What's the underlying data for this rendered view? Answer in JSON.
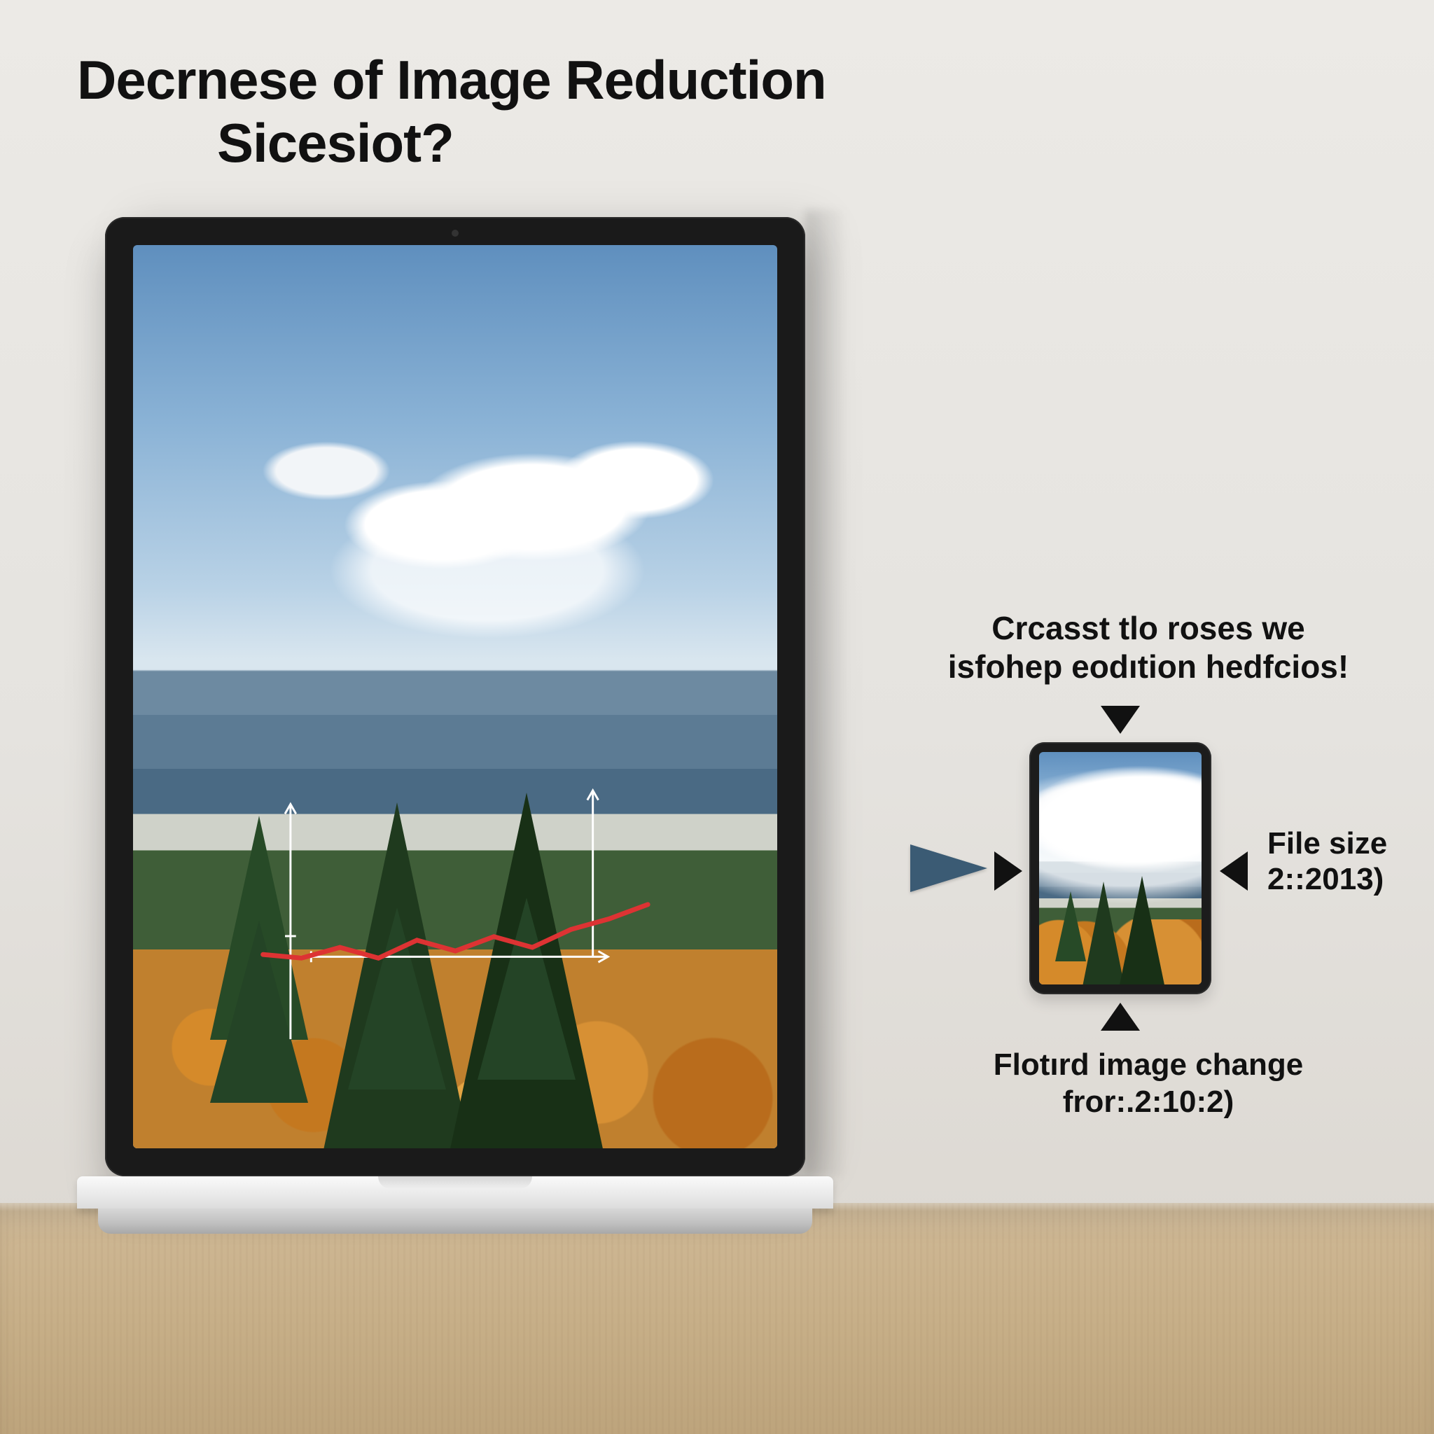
{
  "title": {
    "line1": "Decrnese of Image Reduction",
    "line2": "Sicesiot?"
  },
  "caption": {
    "line1": "Crcasst tlo roses we",
    "line2": "isfohep eodıtion hedfcios!"
  },
  "right_label": {
    "line1": "File size",
    "line2": "2::2013)"
  },
  "bottom_label": {
    "line1": "Flotırd image change",
    "line2": "fror:.2:10:2)"
  },
  "arrows": {
    "top": "down-triangle-icon",
    "bottom": "up-triangle-icon",
    "left": "right-triangle-icon",
    "right": "left-triangle-icon",
    "pointer": "pointer-triangle-icon"
  },
  "chart_data": {
    "type": "line",
    "title": "",
    "xlabel": "",
    "ylabel": "",
    "x": [
      0,
      1,
      2,
      3,
      4,
      5,
      6,
      7,
      8,
      9,
      10
    ],
    "values": [
      32,
      30,
      36,
      30,
      40,
      34,
      42,
      36,
      46,
      52,
      60
    ],
    "ylim": [
      0,
      100
    ],
    "series_color": "#d33",
    "axes_color": "#ffffff"
  }
}
